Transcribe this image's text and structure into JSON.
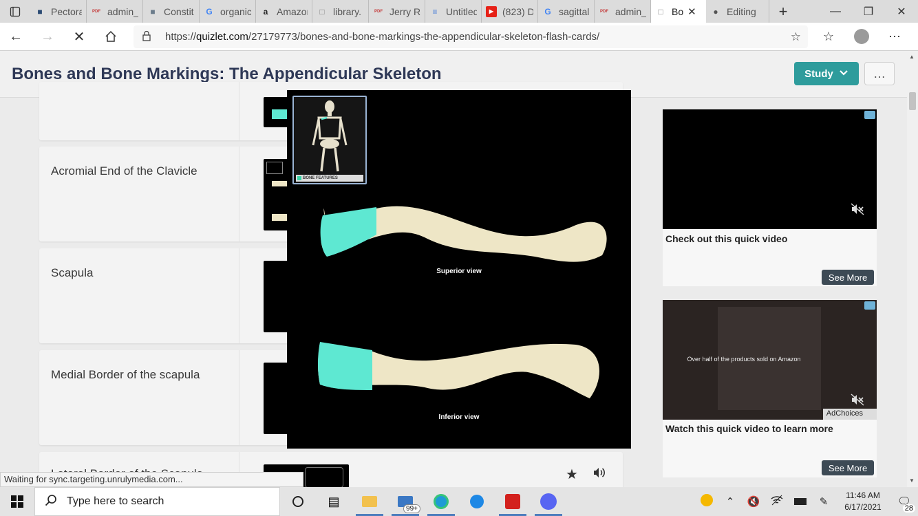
{
  "browser": {
    "tabs": [
      {
        "label": "Pectora",
        "icon": "image-icon",
        "color": "#2a4a73"
      },
      {
        "label": "admin_",
        "icon": "pdf-icon",
        "color": "#c43b3b"
      },
      {
        "label": "Constit",
        "icon": "image-icon",
        "color": "#6b7c8b"
      },
      {
        "label": "organic",
        "icon": "google-icon",
        "color": "#4285f4"
      },
      {
        "label": "Amazon",
        "icon": "amazon-icon",
        "color": "#222222"
      },
      {
        "label": "library.",
        "icon": "page-icon",
        "color": "#888888"
      },
      {
        "label": "Jerry R.",
        "icon": "pdf-icon",
        "color": "#c43b3b"
      },
      {
        "label": "Untitled",
        "icon": "docs-icon",
        "color": "#4a7fd8"
      },
      {
        "label": "(823) D",
        "icon": "youtube-icon",
        "color": "#e62117"
      },
      {
        "label": "sagittal",
        "icon": "google-icon",
        "color": "#4285f4"
      },
      {
        "label": "admin_",
        "icon": "pdf-icon",
        "color": "#c43b3b"
      },
      {
        "label": "Bo",
        "icon": "page-icon",
        "color": "#888888",
        "active": true
      },
      {
        "label": "Editing",
        "icon": "globe-icon",
        "color": "#555555"
      }
    ],
    "url_prefix": "https://",
    "url_host": "quizlet.com",
    "url_path": "/27179773/bones-and-bone-markings-the-appendicular-skeleton-flash-cards/",
    "status_text": "Waiting for sync.targeting.unrulymedia.com..."
  },
  "page": {
    "title": "Bones and Bone Markings: The Appendicular Skeleton",
    "study_label": "Study",
    "more_label": "…"
  },
  "cards": [
    {
      "term": ""
    },
    {
      "term": "Acromial End of the Clavicle"
    },
    {
      "term": "Scapula"
    },
    {
      "term": "Medial Border of the scapula"
    },
    {
      "term": "Lateral Border of the Scapula"
    }
  ],
  "overlay": {
    "inset_label": "BONE FEATURES",
    "superior_label": "Superior view",
    "inferior_label": "Inferior view",
    "highlight_color": "#5ee8d2",
    "bone_color": "#eee6c6"
  },
  "ads": [
    {
      "caption": "Check out this quick video",
      "see_more": "See More"
    },
    {
      "caption": "Watch this quick video to learn more",
      "see_more": "See More",
      "overlay_text": "Over half of the products sold on Amazon",
      "adchoices": "AdChoices"
    }
  ],
  "taskbar": {
    "search_placeholder": "Type here to search",
    "mail_badge": "99+",
    "time": "11:46 AM",
    "date": "6/17/2021",
    "notification_count": "28"
  }
}
